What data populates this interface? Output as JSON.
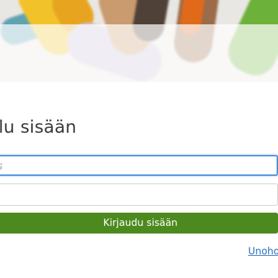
{
  "header": {
    "background_image": "colored-pencils-photo"
  },
  "form": {
    "title": "lu sisään",
    "username_placeholder": "nus",
    "password_value": "",
    "submit_label": "Kirjaudu sisään",
    "forgot_link": "Unoho"
  },
  "colors": {
    "accent_blue": "#4a90d9",
    "button_green": "#4c8a1f",
    "link_blue": "#2a6ebc",
    "title_text": "#3a3a3a"
  }
}
